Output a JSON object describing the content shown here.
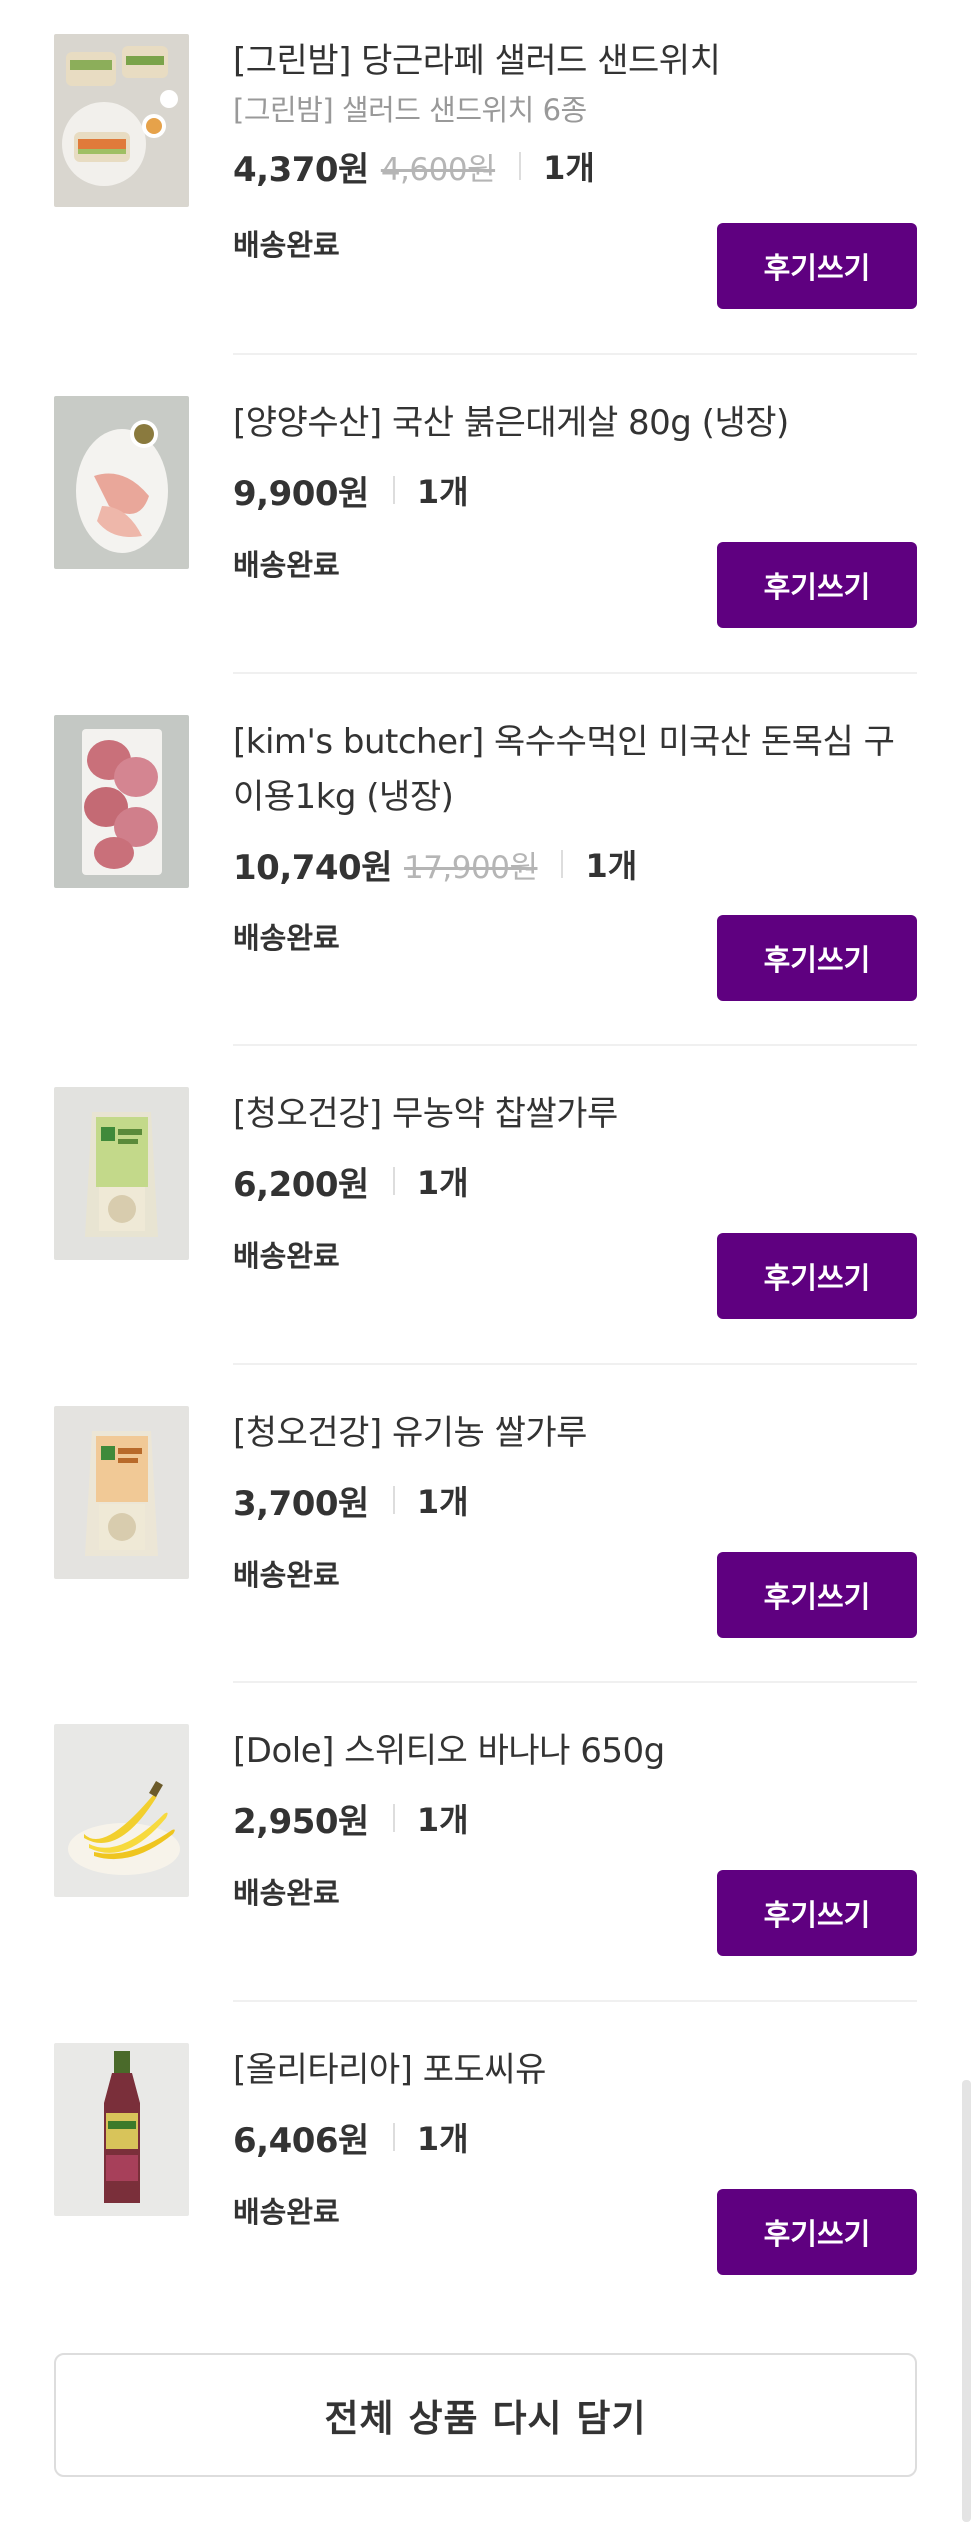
{
  "colors": {
    "accent": "#5f0080",
    "divider": "#f0f0f0",
    "muted": "#999999"
  },
  "items": [
    {
      "name": "[그린밤] 당근라페 샐러드 샌드위치",
      "subtitle": "[그린밤] 샐러드 샌드위치 6종",
      "price": "4,370원",
      "original_price": "4,600원",
      "quantity": "1개",
      "status": "배송완료",
      "review_label": "후기쓰기",
      "thumbnail_icon": "sandwich-thumbnail"
    },
    {
      "name": "[양양수산] 국산 붉은대게살 80g (냉장)",
      "price": "9,900원",
      "quantity": "1개",
      "status": "배송완료",
      "review_label": "후기쓰기",
      "thumbnail_icon": "crab-thumbnail"
    },
    {
      "name": "[kim's butcher] 옥수수먹인 미국산 돈목심 구이용1kg (냉장)",
      "price": "10,740원",
      "original_price": "17,900원",
      "quantity": "1개",
      "status": "배송완료",
      "review_label": "후기쓰기",
      "thumbnail_icon": "pork-thumbnail"
    },
    {
      "name": "[청오건강] 무농약 찹쌀가루",
      "price": "6,200원",
      "quantity": "1개",
      "status": "배송완료",
      "review_label": "후기쓰기",
      "thumbnail_icon": "rice-flour-bag-thumbnail"
    },
    {
      "name": "[청오건강] 유기농 쌀가루",
      "price": "3,700원",
      "quantity": "1개",
      "status": "배송완료",
      "review_label": "후기쓰기",
      "thumbnail_icon": "rice-flour-bag-thumbnail"
    },
    {
      "name": "[Dole] 스위티오 바나나 650g",
      "price": "2,950원",
      "quantity": "1개",
      "status": "배송완료",
      "review_label": "후기쓰기",
      "thumbnail_icon": "banana-thumbnail"
    },
    {
      "name": "[올리타리아] 포도씨유",
      "price": "6,406원",
      "quantity": "1개",
      "status": "배송완료",
      "review_label": "후기쓰기",
      "thumbnail_icon": "oil-bottle-thumbnail"
    }
  ],
  "readd_all_label": "전체 상품 다시 담기"
}
